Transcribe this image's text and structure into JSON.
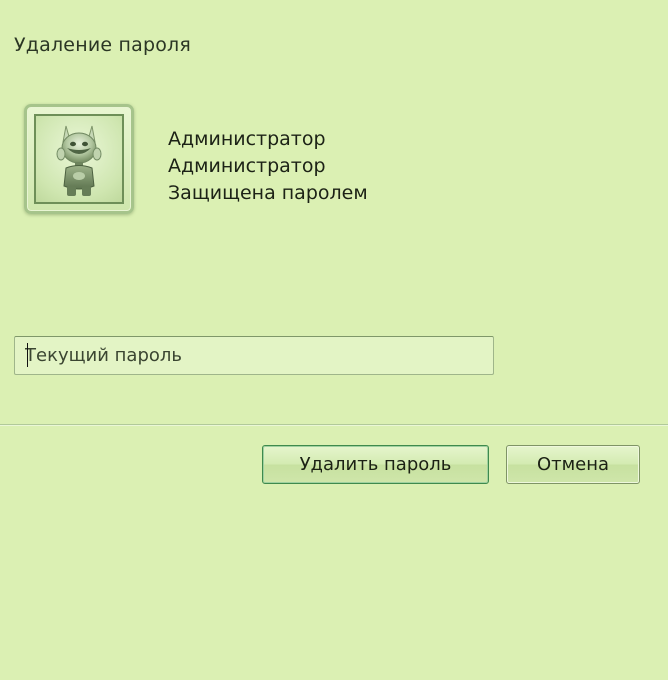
{
  "page": {
    "title": "Удаление пароля"
  },
  "user": {
    "name": "Администратор",
    "account_type": "Администратор",
    "status": "Защищена паролем",
    "avatar_icon": "robot-avatar-icon"
  },
  "password_field": {
    "placeholder": "Текущий пароль",
    "value": ""
  },
  "buttons": {
    "remove_password": "Удалить пароль",
    "cancel": "Отмена"
  },
  "colors": {
    "background": "#dbf0b3",
    "primary_button_border": "#3f8a4d",
    "text": "#1d2418"
  }
}
